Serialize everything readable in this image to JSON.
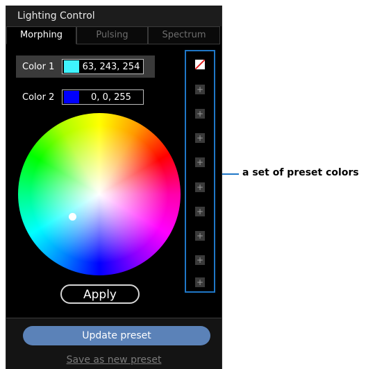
{
  "window": {
    "title": "Lighting Control"
  },
  "tabs": [
    {
      "label": "Morphing",
      "active": true
    },
    {
      "label": "Pulsing",
      "active": false
    },
    {
      "label": "Spectrum",
      "active": false
    }
  ],
  "color1": {
    "label": "Color 1",
    "value": "63, 243, 254",
    "swatch": "#3ff3fe"
  },
  "color2": {
    "label": "Color 2",
    "value": "0, 0, 255",
    "swatch": "#0000ff"
  },
  "apply_label": "Apply",
  "update_preset_label": "Update preset",
  "save_new_preset_label": "Save as new preset",
  "presets": {
    "slots": [
      "none",
      "add",
      "add",
      "add",
      "add",
      "add",
      "add",
      "add",
      "add",
      "add"
    ],
    "add_glyph": "+"
  },
  "callout": {
    "text": "a set of preset colors"
  },
  "colors": {
    "accent": "#1f77c7",
    "update_button": "#5b82b8"
  }
}
